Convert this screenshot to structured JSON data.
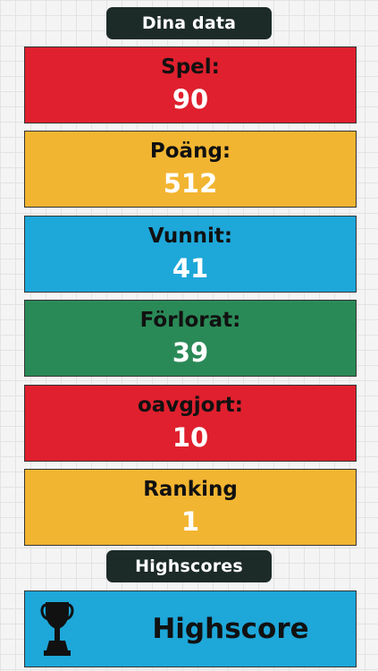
{
  "header": {
    "title": "Dina data"
  },
  "stats": [
    {
      "label": "Spel:",
      "value": "90",
      "color": "#e0202e"
    },
    {
      "label": "Poäng:",
      "value": "512",
      "color": "#f2b531"
    },
    {
      "label": "Vunnit:",
      "value": "41",
      "color": "#1ea7d9"
    },
    {
      "label": "Förlorat:",
      "value": "39",
      "color": "#2a8a57"
    },
    {
      "label": "oavgjort:",
      "value": "10",
      "color": "#e0202e"
    },
    {
      "label": "Ranking",
      "value": "1",
      "color": "#f2b531"
    }
  ],
  "highscores_section": {
    "title": "Highscores",
    "button_label": "Highscore",
    "button_color": "#1ea7d9",
    "icon": "trophy-icon"
  },
  "colors": {
    "pill_bg": "#1d2b28",
    "background": "#f4f4f4"
  }
}
